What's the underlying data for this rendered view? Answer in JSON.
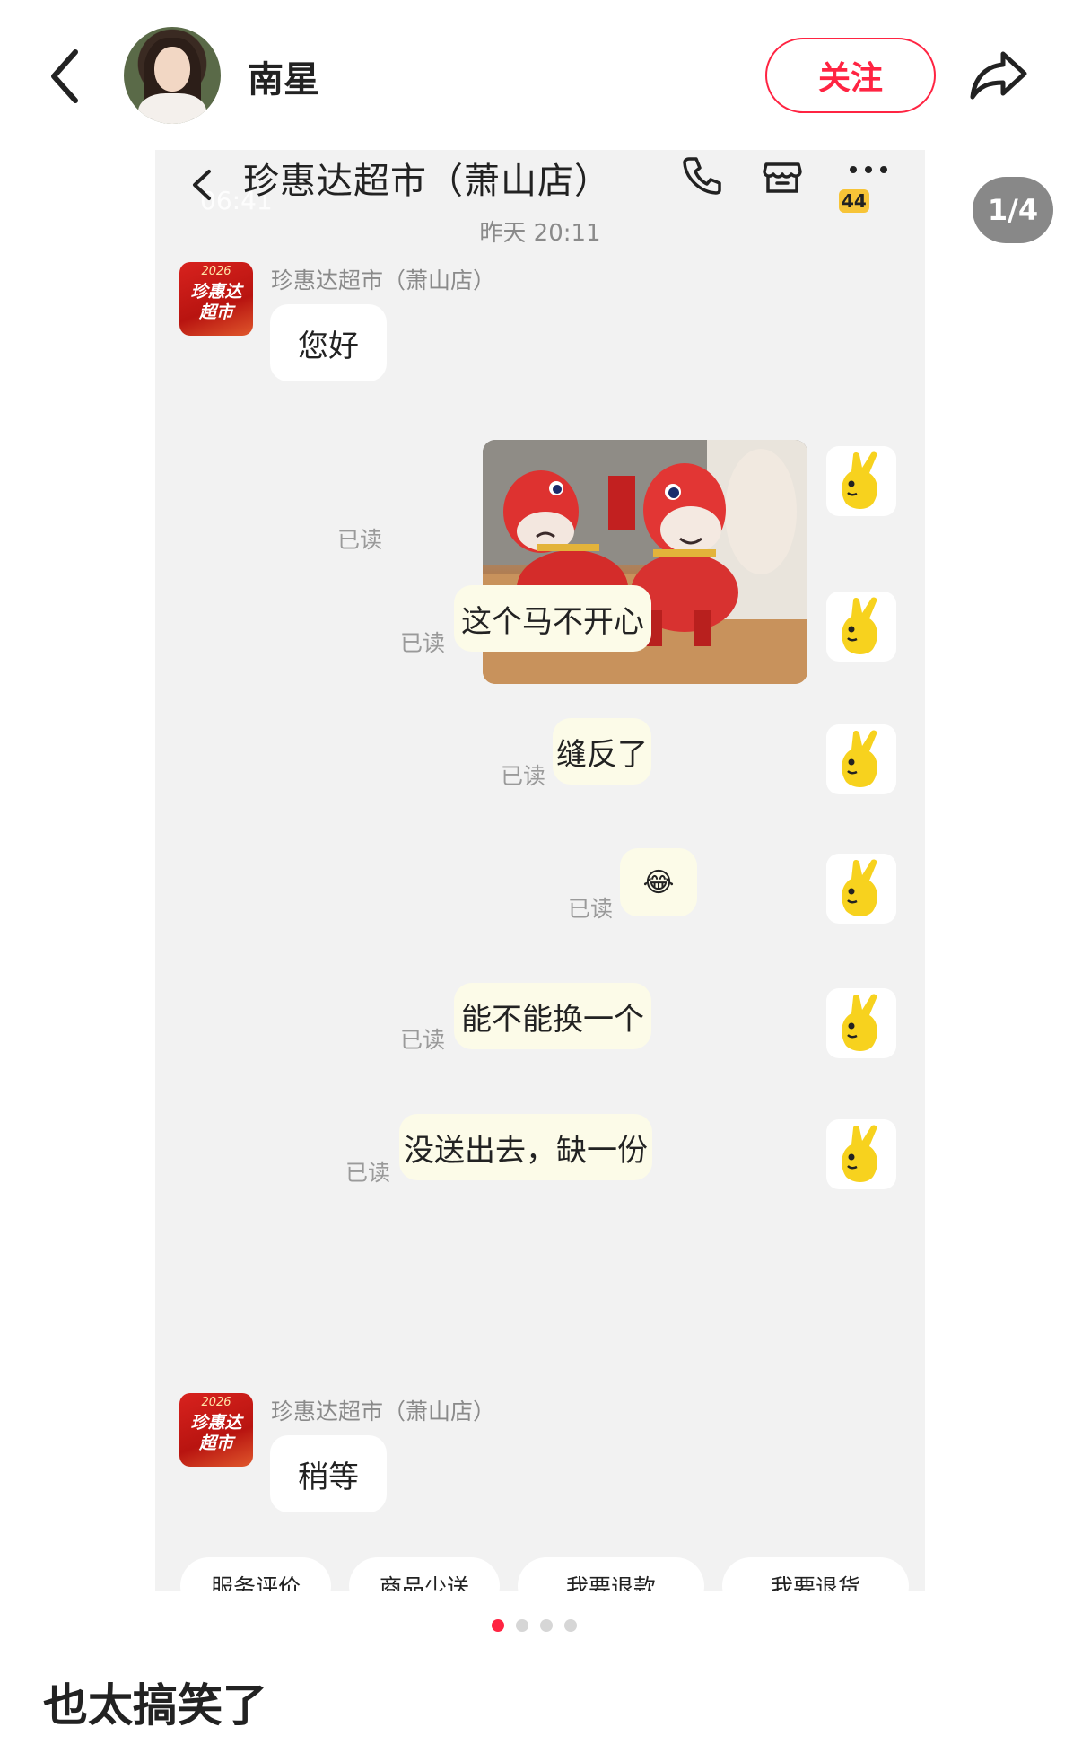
{
  "header": {
    "username": "南星",
    "follow_label": "关注"
  },
  "page_indicator": "1/4",
  "screenshot": {
    "status_time": "06:41",
    "title": "珍惠达超市（萧山店）",
    "badge_count": "44",
    "timestamp": "昨天 20:11",
    "merchant_avatar": {
      "year": "2026",
      "line1": "珍惠达",
      "line2": "超市"
    },
    "messages": [
      {
        "side": "left",
        "sender": "珍惠达超市（萧山店）",
        "text": "您好"
      },
      {
        "side": "right",
        "type": "image",
        "read": "已读"
      },
      {
        "side": "right",
        "text": "这个马不开心",
        "read": "已读"
      },
      {
        "side": "right",
        "text": "缝反了",
        "read": "已读"
      },
      {
        "side": "right",
        "text": "😂",
        "read": "已读"
      },
      {
        "side": "right",
        "text": "能不能换一个",
        "read": "已读"
      },
      {
        "side": "right",
        "text": "没送出去，缺一份",
        "read": "已读"
      },
      {
        "side": "left",
        "sender": "珍惠达超市（萧山店）",
        "text": "稍等"
      }
    ],
    "quick_actions": [
      "服务评价",
      "商品少送",
      "我要退款",
      "我要退货"
    ]
  },
  "carousel": {
    "count": 4,
    "active": 0
  },
  "caption": "也太搞笑了",
  "colors": {
    "accent": "#ff2442",
    "bubble_right": "#fcfbe8",
    "chat_bg": "#f2f2f2"
  }
}
